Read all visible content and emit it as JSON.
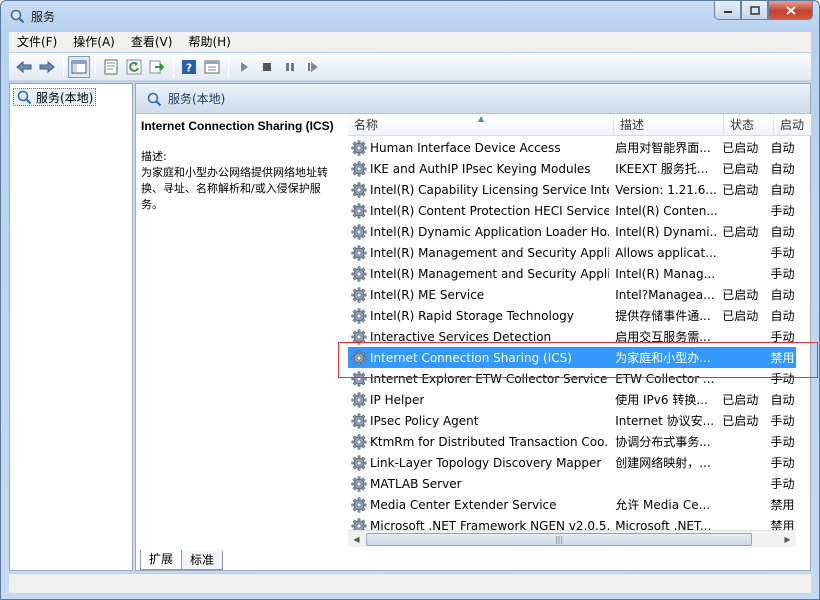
{
  "window": {
    "title": "服务"
  },
  "menu": [
    "文件(F)",
    "操作(A)",
    "查看(V)",
    "帮助(H)"
  ],
  "tree": {
    "root": "服务(本地)"
  },
  "panel": {
    "header": "服务(本地)"
  },
  "description": {
    "title": "Internet Connection Sharing (ICS)",
    "label": "描述:",
    "body": "为家庭和小型办公网络提供网络地址转换、寻址、名称解析和/或入侵保护服务。"
  },
  "columns": {
    "name": "名称",
    "desc": "描述",
    "status": "状态",
    "startup": "启动"
  },
  "services": [
    {
      "name": "Human Interface Device Access",
      "desc": "启用对智能界面...",
      "status": "已启动",
      "startup": "自动"
    },
    {
      "name": "IKE and AuthIP IPsec Keying Modules",
      "desc": "IKEEXT 服务托...",
      "status": "已启动",
      "startup": "自动"
    },
    {
      "name": "Intel(R) Capability Licensing Service Inte...",
      "desc": "Version: 1.21.6...",
      "status": "已启动",
      "startup": "自动"
    },
    {
      "name": "Intel(R) Content Protection HECI Service",
      "desc": "Intel(R) Conten...",
      "status": "",
      "startup": "手动"
    },
    {
      "name": "Intel(R) Dynamic Application Loader Ho...",
      "desc": "Intel(R) Dynami...",
      "status": "已启动",
      "startup": "自动"
    },
    {
      "name": "Intel(R) Management and Security Appli...",
      "desc": "Allows applicat...",
      "status": "",
      "startup": "手动"
    },
    {
      "name": "Intel(R) Management and Security Appli...",
      "desc": "Intel(R) Manag...",
      "status": "",
      "startup": "手动"
    },
    {
      "name": "Intel(R) ME Service",
      "desc": "Intel?Managea...",
      "status": "已启动",
      "startup": "自动"
    },
    {
      "name": "Intel(R) Rapid Storage Technology",
      "desc": "提供存储事件通...",
      "status": "已启动",
      "startup": "自动"
    },
    {
      "name": "Interactive Services Detection",
      "desc": "启用交互服务需...",
      "status": "",
      "startup": "手动"
    },
    {
      "name": "Internet Connection Sharing (ICS)",
      "desc": "为家庭和小型办...",
      "status": "",
      "startup": "禁用"
    },
    {
      "name": "Internet Explorer ETW Collector Service",
      "desc": "ETW Collector ...",
      "status": "",
      "startup": "手动"
    },
    {
      "name": "IP Helper",
      "desc": "使用 IPv6 转换...",
      "status": "已启动",
      "startup": "自动"
    },
    {
      "name": "IPsec Policy Agent",
      "desc": "Internet 协议安...",
      "status": "已启动",
      "startup": "手动"
    },
    {
      "name": "KtmRm for Distributed Transaction Coo...",
      "desc": "协调分布式事务...",
      "status": "",
      "startup": "手动"
    },
    {
      "name": "Link-Layer Topology Discovery Mapper",
      "desc": "创建网络映射，...",
      "status": "",
      "startup": "手动"
    },
    {
      "name": "MATLAB Server",
      "desc": "",
      "status": "",
      "startup": "手动"
    },
    {
      "name": "Media Center Extender Service",
      "desc": "允许 Media Ce...",
      "status": "",
      "startup": "禁用"
    },
    {
      "name": "Microsoft .NET Framework NGEN v2.0.5...",
      "desc": "Microsoft .NET...",
      "status": "",
      "startup": "禁用"
    }
  ],
  "selected_index": 10,
  "tabs": [
    "扩展",
    "标准"
  ],
  "active_tab": 0,
  "colors": {
    "selection": "#3399ff",
    "highlight_box": "#e03535"
  }
}
